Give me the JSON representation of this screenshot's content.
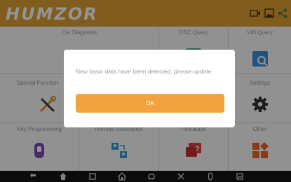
{
  "app": {
    "logo": "HUMZOR"
  },
  "header": {
    "icons": [
      "screen-record-icon",
      "gallery-icon",
      "share-icon"
    ]
  },
  "tiles": [
    {
      "label": "Car Diagnosis",
      "icon": "car-diagnosis-icon"
    },
    {
      "label": "DTC Query",
      "icon": "dtc-query-icon"
    },
    {
      "label": "VIN Query",
      "icon": "vin-query-icon"
    },
    {
      "label": "Special Function",
      "icon": "special-function-icon"
    },
    {
      "label": "Settings",
      "icon": "gear-icon"
    },
    {
      "label": "Key Programming",
      "icon": "key-icon"
    },
    {
      "label": "Remote Assistance",
      "icon": "remote-assistance-icon"
    },
    {
      "label": "Feedback",
      "icon": "feedback-icon"
    },
    {
      "label": "Other",
      "icon": "other-icon"
    }
  ],
  "dialog": {
    "message": "New basic data have been detected, please update.",
    "ok_label": "OK"
  },
  "colors": {
    "accent": "#dd9f32",
    "button": "#f2a33d",
    "navbar": "#141414"
  },
  "navbar": {
    "icons": [
      "back-icon",
      "home-icon",
      "recent-apps-icon",
      "house-icon",
      "car-icon",
      "tools-icon",
      "key-icon",
      "screenshot-icon"
    ]
  }
}
